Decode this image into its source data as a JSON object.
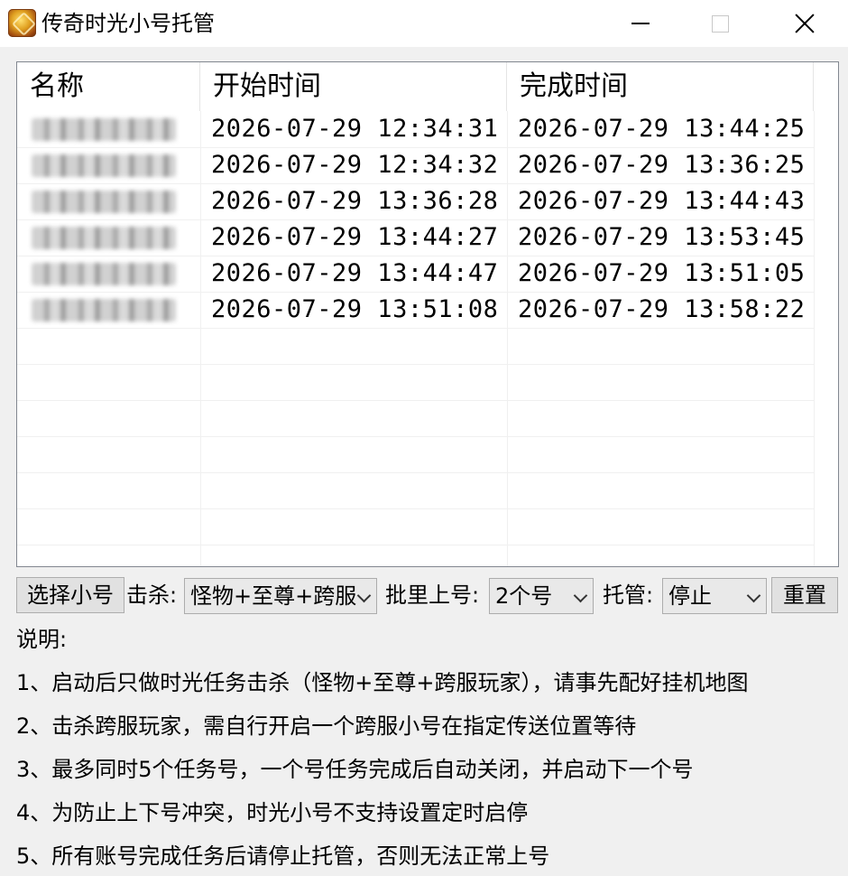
{
  "window": {
    "title": "传奇时光小号托管",
    "icon": "game-app-icon"
  },
  "list": {
    "columns": [
      "名称",
      "开始时间",
      "完成时间"
    ],
    "rows": [
      {
        "name": "",
        "start": "2026-07-29 12:34:31",
        "end": "2026-07-29 13:44:25"
      },
      {
        "name": "",
        "start": "2026-07-29 12:34:32",
        "end": "2026-07-29 13:36:25"
      },
      {
        "name": "",
        "start": "2026-07-29 13:36:28",
        "end": "2026-07-29 13:44:43"
      },
      {
        "name": "",
        "start": "2026-07-29 13:44:27",
        "end": "2026-07-29 13:53:45"
      },
      {
        "name": "",
        "start": "2026-07-29 13:44:47",
        "end": "2026-07-29 13:51:05"
      },
      {
        "name": "",
        "start": "2026-07-29 13:51:08",
        "end": "2026-07-29 13:58:22"
      }
    ]
  },
  "controls": {
    "select_button": "选择小号",
    "kill_label": "击杀:",
    "kill_value": "怪物+至尊+跨服",
    "batch_label": "批里上号:",
    "batch_value": "2个号",
    "host_label": "托管:",
    "host_value": "停止",
    "reset_button": "重置"
  },
  "notes": {
    "title": "说明:",
    "items": [
      "1、启动后只做时光任务击杀（怪物+至尊+跨服玩家），请事先配好挂机地图",
      "2、击杀跨服玩家，需自行开启一个跨服小号在指定传送位置等待",
      "3、最多同时5个任务号，一个号任务完成后自动关闭，并启动下一个号",
      "4、为防止上下号冲突，时光小号不支持设置定时启停",
      "5、所有账号完成任务后请停止托管，否则无法正常上号"
    ]
  }
}
